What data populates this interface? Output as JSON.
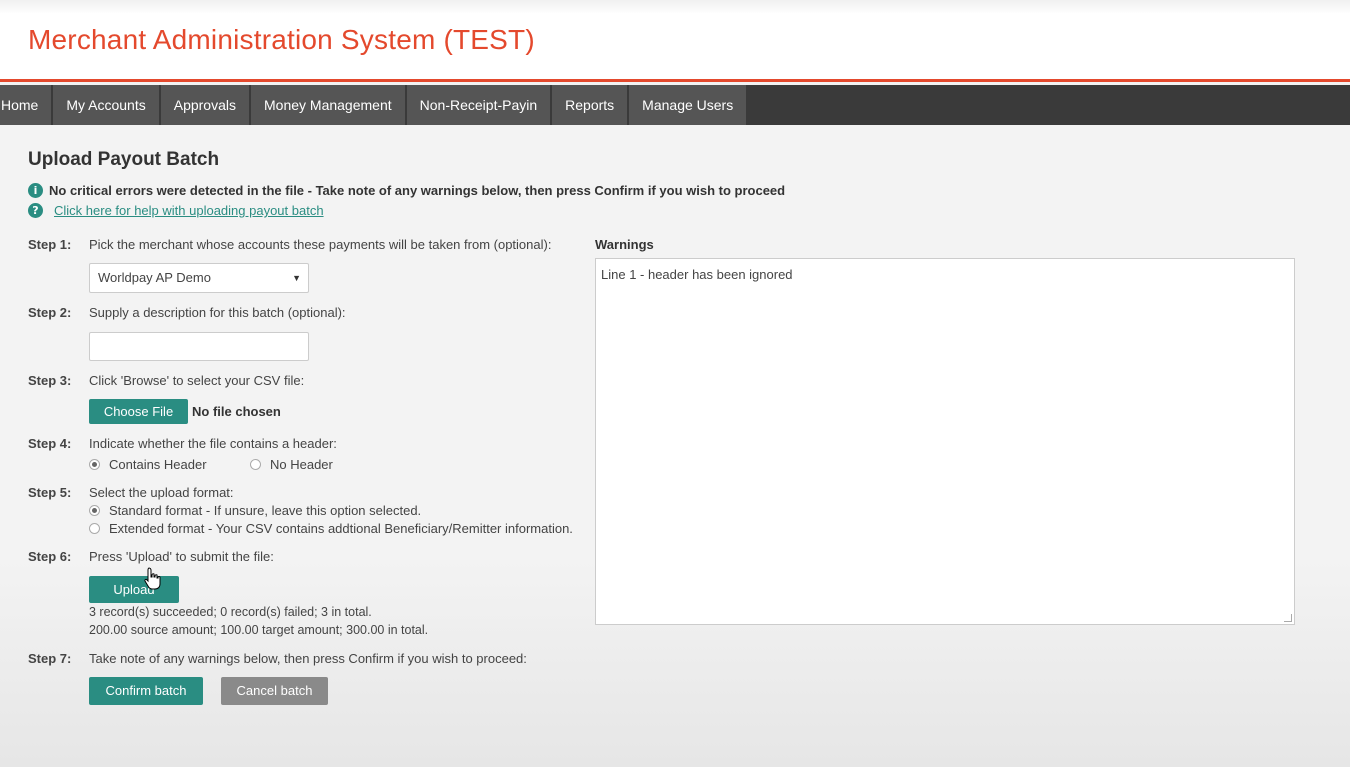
{
  "header": {
    "title": "Merchant Administration System (TEST)"
  },
  "nav": {
    "items": [
      {
        "label": "Home"
      },
      {
        "label": "My Accounts"
      },
      {
        "label": "Approvals"
      },
      {
        "label": "Money Management"
      },
      {
        "label": "Non-Receipt-Payin"
      },
      {
        "label": "Reports"
      },
      {
        "label": "Manage Users"
      }
    ]
  },
  "page": {
    "title": "Upload Payout Batch",
    "info_icon": "info-icon",
    "info_message": "No critical errors were detected in the file - Take note of any warnings below, then press Confirm if you wish to proceed",
    "help_icon": "help-icon",
    "help_link": "Click here for help with uploading payout batch"
  },
  "steps": {
    "s1": {
      "label": "Step 1:",
      "text": "Pick the merchant whose accounts these payments will be taken from (optional):"
    },
    "s2": {
      "label": "Step 2:",
      "text": "Supply a description for this batch (optional):"
    },
    "s3": {
      "label": "Step 3:",
      "text": "Click 'Browse' to select your CSV file:"
    },
    "s4": {
      "label": "Step 4:",
      "text": "Indicate whether the file contains a header:"
    },
    "s5": {
      "label": "Step 5:",
      "text": "Select the upload format:"
    },
    "s6": {
      "label": "Step 6:",
      "text": "Press 'Upload' to submit the file:"
    },
    "s7": {
      "label": "Step 7:",
      "text": "Take note of any warnings below, then press Confirm if you wish to proceed:"
    }
  },
  "merchant_select": {
    "value": "Worldpay AP Demo",
    "caret": "▼"
  },
  "description_input": {
    "value": ""
  },
  "file": {
    "button_label": "Choose File",
    "status": "No file chosen"
  },
  "header_options": {
    "contains_header": {
      "label": "Contains Header",
      "checked": true
    },
    "no_header": {
      "label": "No Header",
      "checked": false
    }
  },
  "format_options": {
    "standard": {
      "label": "Standard format - If unsure, leave this option selected.",
      "checked": true
    },
    "extended": {
      "label": "Extended format - Your CSV contains addtional Beneficiary/Remitter information.",
      "checked": false
    }
  },
  "upload": {
    "button_label": "Upload",
    "result_line1": "3 record(s) succeeded; 0 record(s) failed; 3 in total.",
    "result_line2": "200.00 source amount; 100.00 target amount; 300.00 in total."
  },
  "actions": {
    "confirm_label": "Confirm batch",
    "cancel_label": "Cancel batch"
  },
  "warnings": {
    "label": "Warnings",
    "content": "Line 1 - header has been ignored"
  },
  "colors": {
    "accent_red": "#e4492d",
    "teal": "#2a8d82",
    "nav_bg": "#3a3a3a"
  }
}
